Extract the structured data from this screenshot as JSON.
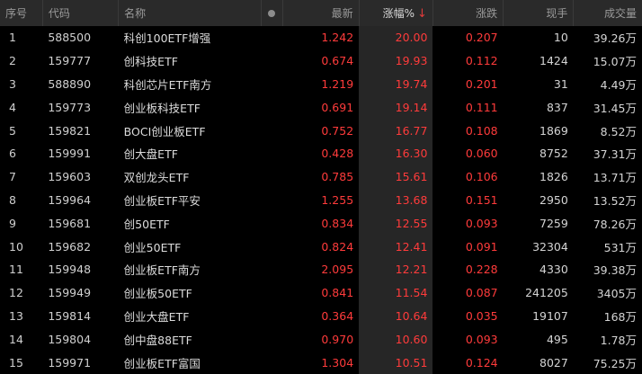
{
  "header": {
    "seq": "序号",
    "code": "代码",
    "name": "名称",
    "last": "最新",
    "pct": "涨幅%",
    "chg": "涨跌",
    "vol": "现手",
    "amount": "成交量",
    "sort_arrow": "↓"
  },
  "colors": {
    "up": "#ff3b3b",
    "header_bg": "#2a2a2a",
    "sorted_col_bg": "#262626"
  },
  "rows": [
    {
      "seq": "1",
      "code": "588500",
      "name": "科创100ETF增强",
      "last": "1.242",
      "pct": "20.00",
      "chg": "0.207",
      "vol": "10",
      "amount": "39.26万"
    },
    {
      "seq": "2",
      "code": "159777",
      "name": "创科技ETF",
      "last": "0.674",
      "pct": "19.93",
      "chg": "0.112",
      "vol": "1424",
      "amount": "15.07万"
    },
    {
      "seq": "3",
      "code": "588890",
      "name": "科创芯片ETF南方",
      "last": "1.219",
      "pct": "19.74",
      "chg": "0.201",
      "vol": "31",
      "amount": "4.49万"
    },
    {
      "seq": "4",
      "code": "159773",
      "name": "创业板科技ETF",
      "last": "0.691",
      "pct": "19.14",
      "chg": "0.111",
      "vol": "837",
      "amount": "31.45万"
    },
    {
      "seq": "5",
      "code": "159821",
      "name": "BOCI创业板ETF",
      "last": "0.752",
      "pct": "16.77",
      "chg": "0.108",
      "vol": "1869",
      "amount": "8.52万"
    },
    {
      "seq": "6",
      "code": "159991",
      "name": "创大盘ETF",
      "last": "0.428",
      "pct": "16.30",
      "chg": "0.060",
      "vol": "8752",
      "amount": "37.31万"
    },
    {
      "seq": "7",
      "code": "159603",
      "name": "双创龙头ETF",
      "last": "0.785",
      "pct": "15.61",
      "chg": "0.106",
      "vol": "1826",
      "amount": "13.71万"
    },
    {
      "seq": "8",
      "code": "159964",
      "name": "创业板ETF平安",
      "last": "1.255",
      "pct": "13.68",
      "chg": "0.151",
      "vol": "2950",
      "amount": "13.52万"
    },
    {
      "seq": "9",
      "code": "159681",
      "name": "创50ETF",
      "last": "0.834",
      "pct": "12.55",
      "chg": "0.093",
      "vol": "7259",
      "amount": "78.26万"
    },
    {
      "seq": "10",
      "code": "159682",
      "name": "创业50ETF",
      "last": "0.824",
      "pct": "12.41",
      "chg": "0.091",
      "vol": "32304",
      "amount": "531万"
    },
    {
      "seq": "11",
      "code": "159948",
      "name": "创业板ETF南方",
      "last": "2.095",
      "pct": "12.21",
      "chg": "0.228",
      "vol": "4330",
      "amount": "39.38万"
    },
    {
      "seq": "12",
      "code": "159949",
      "name": "创业板50ETF",
      "last": "0.841",
      "pct": "11.54",
      "chg": "0.087",
      "vol": "241205",
      "amount": "3405万"
    },
    {
      "seq": "13",
      "code": "159814",
      "name": "创业大盘ETF",
      "last": "0.364",
      "pct": "10.64",
      "chg": "0.035",
      "vol": "19107",
      "amount": "168万"
    },
    {
      "seq": "14",
      "code": "159804",
      "name": "创中盘88ETF",
      "last": "0.970",
      "pct": "10.60",
      "chg": "0.093",
      "vol": "495",
      "amount": "1.78万"
    },
    {
      "seq": "15",
      "code": "159971",
      "name": "创业板ETF富国",
      "last": "1.304",
      "pct": "10.51",
      "chg": "0.124",
      "vol": "8027",
      "amount": "75.25万"
    }
  ]
}
